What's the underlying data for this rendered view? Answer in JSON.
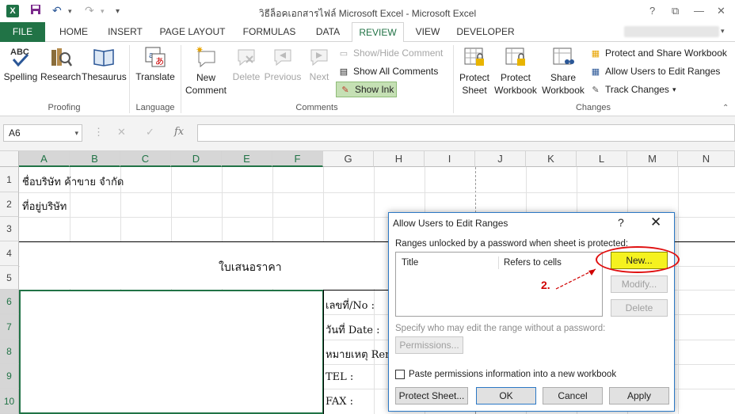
{
  "app": {
    "title": "วิธีล็อคเอกสารไฟล์ Microsoft Excel - Microsoft Excel",
    "logo": "X",
    "help": "?",
    "restore": "⧉",
    "minimize": "—",
    "close": "✕"
  },
  "tabs": [
    "FILE",
    "HOME",
    "INSERT",
    "PAGE LAYOUT",
    "FORMULAS",
    "DATA",
    "REVIEW",
    "VIEW",
    "DEVELOPER"
  ],
  "active_tab": "REVIEW",
  "ribbon": {
    "proofing": {
      "label": "Proofing",
      "spelling": "Spelling",
      "research": "Research",
      "thesaurus": "Thesaurus"
    },
    "language": {
      "label": "Language",
      "translate": "Translate"
    },
    "comments": {
      "label": "Comments",
      "new_comment": "New Comment",
      "delete": "Delete",
      "previous": "Previous",
      "next": "Next",
      "show_hide": "Show/Hide Comment",
      "show_all": "Show All Comments",
      "show_ink": "Show Ink"
    },
    "changes": {
      "label": "Changes",
      "protect_sheet": "Protect Sheet",
      "protect_workbook": "Protect Workbook",
      "share_workbook": "Share Workbook",
      "protect_share": "Protect and Share Workbook",
      "allow_users": "Allow Users to Edit Ranges",
      "track_changes": "Track Changes"
    }
  },
  "formula_bar": {
    "name_box": "A6",
    "fx": "fx",
    "cancel": "✕",
    "enter": "✓",
    "value": ""
  },
  "columns": [
    "A",
    "B",
    "C",
    "D",
    "E",
    "F",
    "G",
    "H",
    "I",
    "J",
    "K",
    "L",
    "M",
    "N"
  ],
  "rows": [
    "1",
    "2",
    "3",
    "4",
    "5",
    "6",
    "7",
    "8",
    "9",
    "10"
  ],
  "cells": {
    "a1": "ชื่อบริษัท ค้าขาย จำกัด",
    "a2": "ที่อยู่บริษัท",
    "title": "ใบเสนอราคา",
    "g6": "เลขที่/No :",
    "g7": "วันที่ Date :",
    "g8": "หมายเหตุ Remark :",
    "g9": "TEL :",
    "g10": "FAX :"
  },
  "dialog": {
    "title": "Allow Users to Edit Ranges",
    "help": "?",
    "close": "✕",
    "ranges_label": "Ranges unlocked by a password when sheet is protected:",
    "col_title": "Title",
    "col_refers": "Refers to cells",
    "new": "New...",
    "modify": "Modify...",
    "delete": "Delete",
    "specify_label": "Specify who may edit the range without a password:",
    "permissions": "Permissions...",
    "paste_label": "Paste permissions information into a new workbook",
    "protect_sheet": "Protect Sheet...",
    "ok": "OK",
    "cancel": "Cancel",
    "apply": "Apply"
  },
  "annotation": {
    "step": "2."
  },
  "colors": {
    "excel_green": "#217346",
    "highlight": "#f5f21f",
    "annotation_red": "#e01010"
  }
}
